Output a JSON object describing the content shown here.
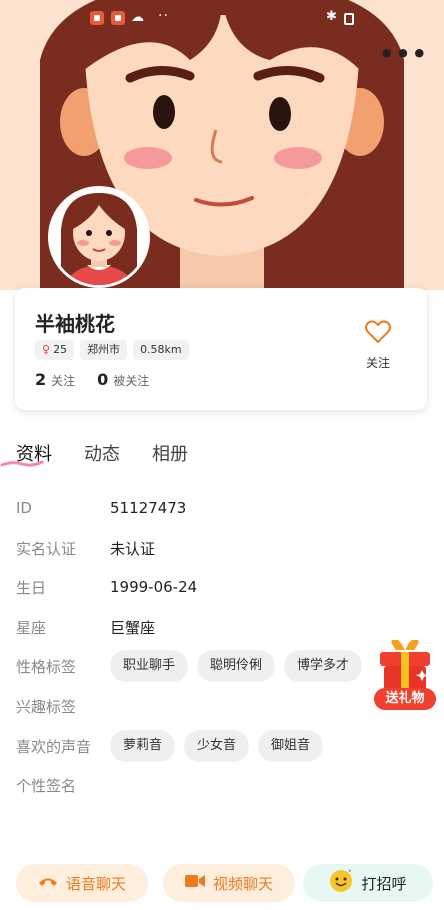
{
  "status_bar": {
    "dots": "··"
  },
  "header": {
    "more_label": "•••"
  },
  "profile": {
    "nickname": "半袖桃花",
    "age": "25",
    "city": "郑州市",
    "distance": "0.58km",
    "following_count": "2",
    "following_label": "关注",
    "followers_count": "0",
    "followers_label": "被关注",
    "follow_button_label": "关注"
  },
  "tabs": [
    {
      "label": "资料",
      "active": true
    },
    {
      "label": "动态",
      "active": false
    },
    {
      "label": "相册",
      "active": false
    }
  ],
  "info": {
    "id_label": "ID",
    "id_value": "51127473",
    "verify_label": "实名认证",
    "verify_value": "未认证",
    "birthday_label": "生日",
    "birthday_value": "1999-06-24",
    "zodiac_label": "星座",
    "zodiac_value": "巨蟹座",
    "personality_label": "性格标签",
    "personality_tags": [
      "职业聊手",
      "聪明伶俐",
      "博学多才"
    ],
    "interest_label": "兴趣标签",
    "voice_label": "喜欢的声音",
    "voice_tags": [
      "萝莉音",
      "少女音",
      "御姐音"
    ],
    "signature_label": "个性签名"
  },
  "gift": {
    "label": "送礼物"
  },
  "actions": {
    "voice_chat": "语音聊天",
    "video_chat": "视频聊天",
    "greet": "打招呼"
  },
  "colors": {
    "accent_orange": "#f07a1e",
    "gift_red": "#f0402f",
    "tab_underline": "#f28ba0"
  }
}
